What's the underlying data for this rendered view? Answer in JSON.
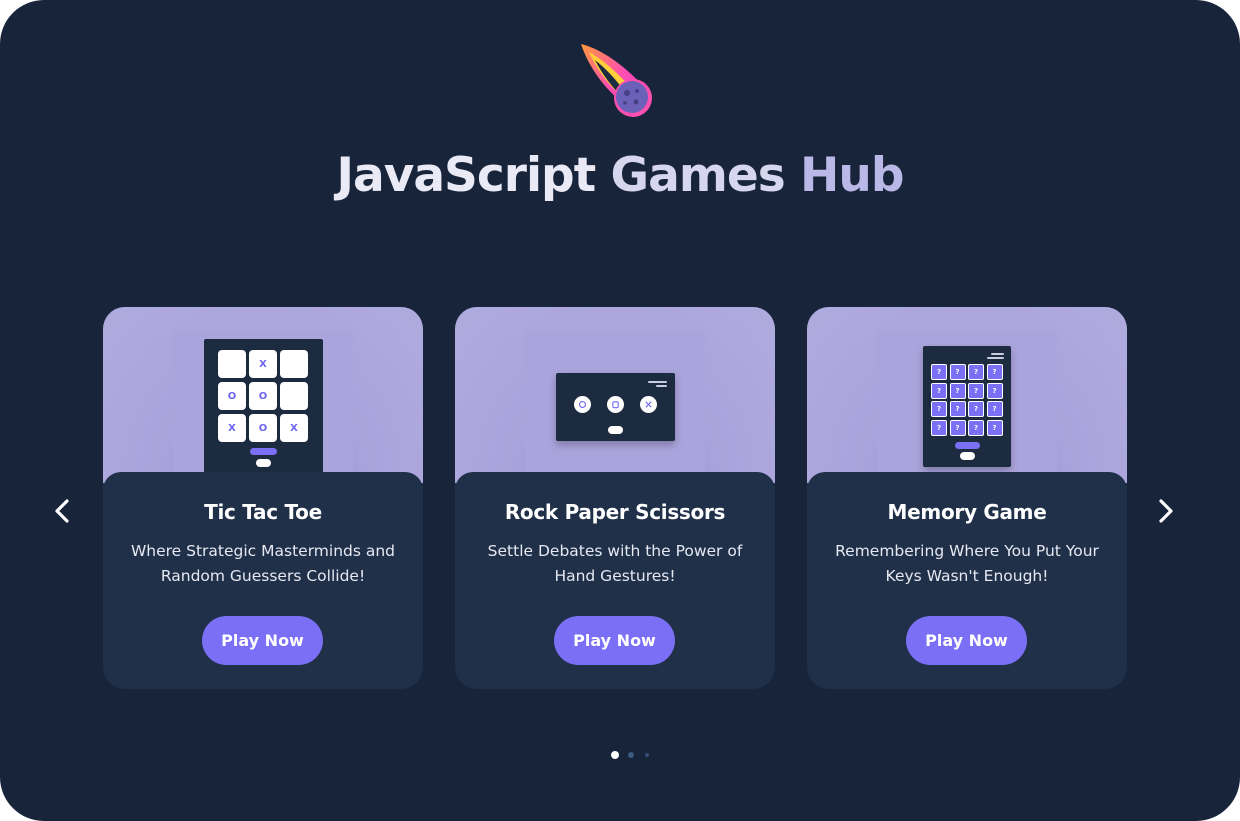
{
  "header": {
    "logo_icon": "meteor-icon",
    "title_parts": [
      "JavaScript",
      "Games",
      "Hub"
    ]
  },
  "carousel": {
    "prev_icon": "chevron-left-icon",
    "next_icon": "chevron-right-icon",
    "cards": [
      {
        "title": "Tic Tac Toe",
        "description": "Where Strategic Masterminds and Random Guessers Collide!",
        "button": "Play Now",
        "preview_board": [
          "",
          "X",
          "",
          "O",
          "O",
          "",
          "X",
          "O",
          "X"
        ]
      },
      {
        "title": "Rock Paper Scissors",
        "description": "Settle Debates with the Power of Hand Gestures!",
        "button": "Play Now",
        "preview_icons": [
          "rock-fist-icon",
          "paper-hand-icon",
          "scissors-hand-icon"
        ]
      },
      {
        "title": "Memory Game",
        "description": "Remembering Where You Put Your Keys Wasn't Enough!",
        "button": "Play Now",
        "preview_cell": "?"
      }
    ],
    "pagination": {
      "pages": 3,
      "active": 1
    }
  },
  "colors": {
    "background": "#18243a",
    "card": "#1f3048",
    "card_top": "#b0abdf",
    "accent": "#7a6ff5",
    "text": "#ffffff"
  }
}
